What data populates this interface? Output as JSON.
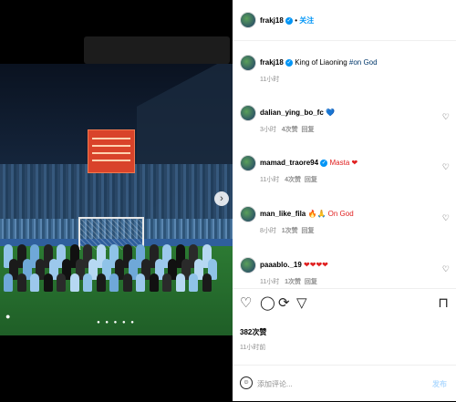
{
  "post": {
    "author": "frakj18",
    "follow_label": "关注",
    "caption_text": "King of Liaoning ",
    "caption_tag": "#on God",
    "caption_time": "11小时",
    "likes": "382次赞",
    "time": "11小时前"
  },
  "comments": [
    {
      "user": "dalian_ying_bo_fc",
      "text": "💙",
      "time": "3小时",
      "likes": "4次赞",
      "reply": "回复",
      "verified": false
    },
    {
      "user": "mamad_traore94",
      "text": "Masta ❤",
      "time": "11小时",
      "likes": "4次赞",
      "reply": "回复",
      "verified": true
    },
    {
      "user": "man_like_fila",
      "text": "🔥🙏 On God",
      "time": "8小时",
      "likes": "1次赞",
      "reply": "回复",
      "verified": false
    },
    {
      "user": "paaablo._19",
      "text": "❤❤❤❤",
      "time": "11小时",
      "likes": "1次赞",
      "reply": "回复",
      "verified": false
    }
  ],
  "composer": {
    "placeholder": "添加评论...",
    "post_label": "发布"
  },
  "colors": {
    "accent": "#0095f6",
    "muted": "#8e8e8e"
  },
  "icons": [
    "heart-icon",
    "comment-icon",
    "share-icon",
    "send-icon",
    "bookmark-icon",
    "emoji-icon",
    "more-icon"
  ]
}
